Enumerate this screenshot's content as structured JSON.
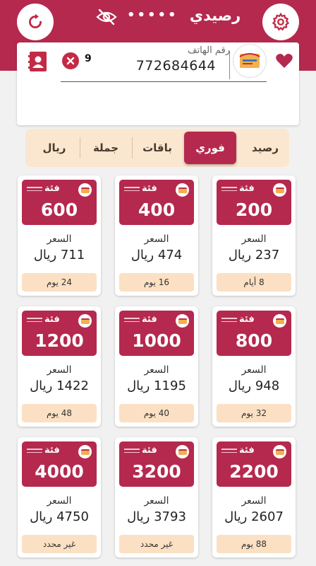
{
  "header": {
    "title": "رصيدي",
    "balance_masked": "•••••",
    "refresh_icon": "refresh-icon",
    "settings_icon": "gear-icon",
    "visibility_icon": "eye-off-icon"
  },
  "recipient": {
    "phone_label": "رقم الهاتف",
    "phone_value": "772684644",
    "count": "9",
    "operator_logo": "operator-logo"
  },
  "tabs": [
    "رصيد",
    "فوري",
    "باقات",
    "جملة",
    "ريال"
  ],
  "active_tab": "فوري",
  "colors": {
    "primary": "#b5294e",
    "accent": "#fbe6cf",
    "background": "#f1f1f1"
  },
  "cards": [
    {
      "category": "فئة",
      "amount": "200",
      "price_label": "السعر",
      "price": "237 ريال",
      "duration": "8 أيام"
    },
    {
      "category": "فئة",
      "amount": "400",
      "price_label": "السعر",
      "price": "474 ريال",
      "duration": "16 يوم"
    },
    {
      "category": "فئة",
      "amount": "600",
      "price_label": "السعر",
      "price": "711 ريال",
      "duration": "24 يوم"
    },
    {
      "category": "فئة",
      "amount": "800",
      "price_label": "السعر",
      "price": "948 ريال",
      "duration": "32 يوم"
    },
    {
      "category": "فئة",
      "amount": "1000",
      "price_label": "السعر",
      "price": "1195 ريال",
      "duration": "40 يوم"
    },
    {
      "category": "فئة",
      "amount": "1200",
      "price_label": "السعر",
      "price": "1422 ريال",
      "duration": "48 يوم"
    },
    {
      "category": "فئة",
      "amount": "2200",
      "price_label": "السعر",
      "price": "2607 ريال",
      "duration": "88 يوم"
    },
    {
      "category": "فئة",
      "amount": "3200",
      "price_label": "السعر",
      "price": "3793 ريال",
      "duration": "غير محدد"
    },
    {
      "category": "فئة",
      "amount": "4000",
      "price_label": "السعر",
      "price": "4750 ريال",
      "duration": "غير محدد"
    }
  ]
}
